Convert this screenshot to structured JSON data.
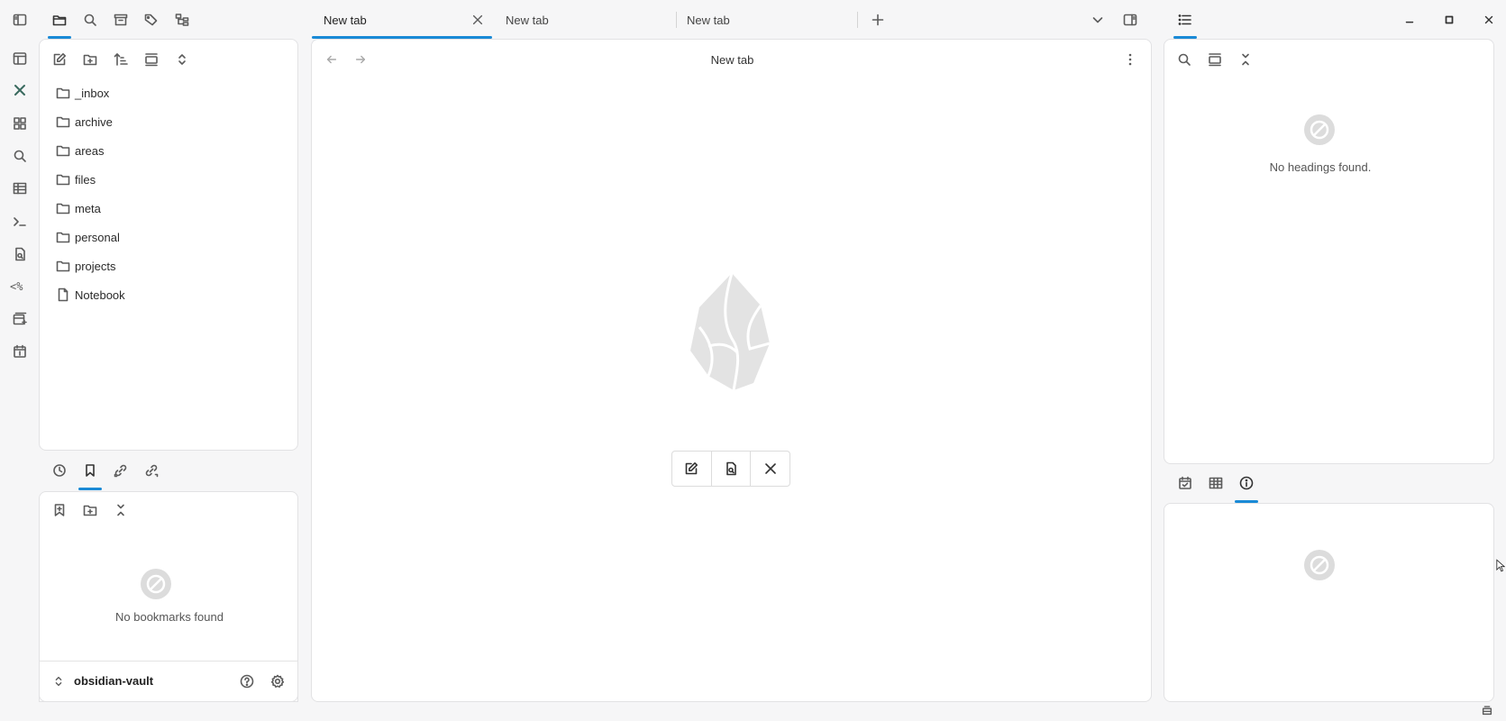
{
  "left_sidebar": {
    "file_tree": [
      {
        "name": "_inbox",
        "type": "folder"
      },
      {
        "name": "archive",
        "type": "folder"
      },
      {
        "name": "areas",
        "type": "folder"
      },
      {
        "name": "files",
        "type": "folder"
      },
      {
        "name": "meta",
        "type": "folder"
      },
      {
        "name": "personal",
        "type": "folder"
      },
      {
        "name": "projects",
        "type": "folder"
      },
      {
        "name": "Notebook",
        "type": "file"
      }
    ],
    "bookmarks_empty": "No bookmarks found",
    "vault_name": "obsidian-vault"
  },
  "tabs": [
    {
      "label": "New tab",
      "active": true
    },
    {
      "label": "New tab",
      "active": false
    },
    {
      "label": "New tab",
      "active": false
    }
  ],
  "main": {
    "view_title": "New tab"
  },
  "right_sidebar": {
    "outline_empty": "No headings found."
  },
  "colors": {
    "accent": "#1a8ad6",
    "background": "#f6f6f7",
    "panel": "#ffffff"
  }
}
